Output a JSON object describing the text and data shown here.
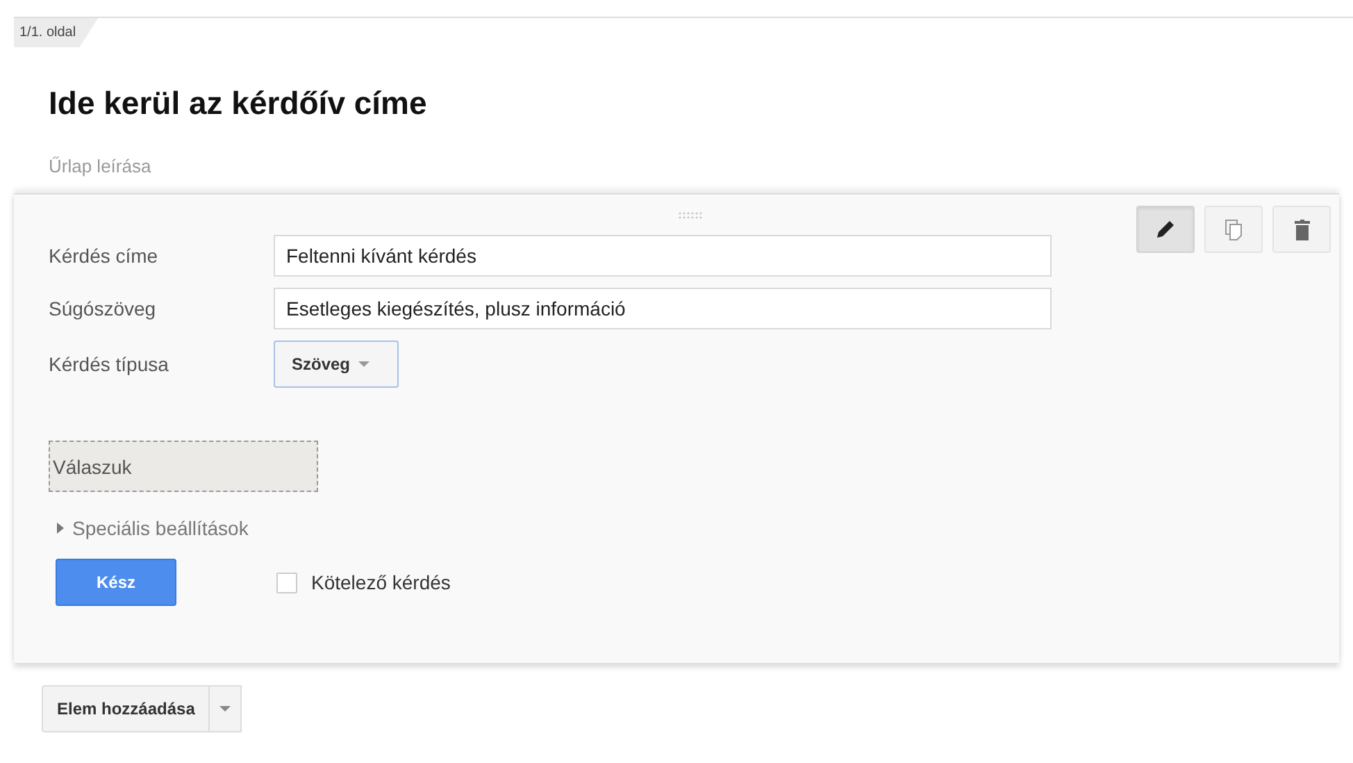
{
  "page_tab": {
    "label": "1/1. oldal"
  },
  "form": {
    "title": "Ide kerül az kérdőív címe",
    "description_placeholder": "Űrlap leírása"
  },
  "question": {
    "toolbar": [
      {
        "kind": "edit",
        "selected": true
      },
      {
        "kind": "duplicate",
        "selected": false
      },
      {
        "kind": "delete",
        "selected": false
      }
    ],
    "fields": [
      {
        "label": "Kérdés címe",
        "value": "Feltenni kívánt kérdés"
      },
      {
        "label": "Súgószöveg",
        "value": "Esetleges kiegészítés, plusz információ"
      }
    ],
    "type": {
      "label": "Kérdés típusa",
      "value": "Szöveg"
    },
    "answer": {
      "placeholder": "Válaszuk"
    },
    "advanced": {
      "label": "Speciális beállítások",
      "expanded": false
    },
    "done_button": "Kész",
    "required": {
      "label": "Kötelező kérdés",
      "checked": false
    }
  },
  "add_item": {
    "label": "Elem hozzáadása"
  }
}
